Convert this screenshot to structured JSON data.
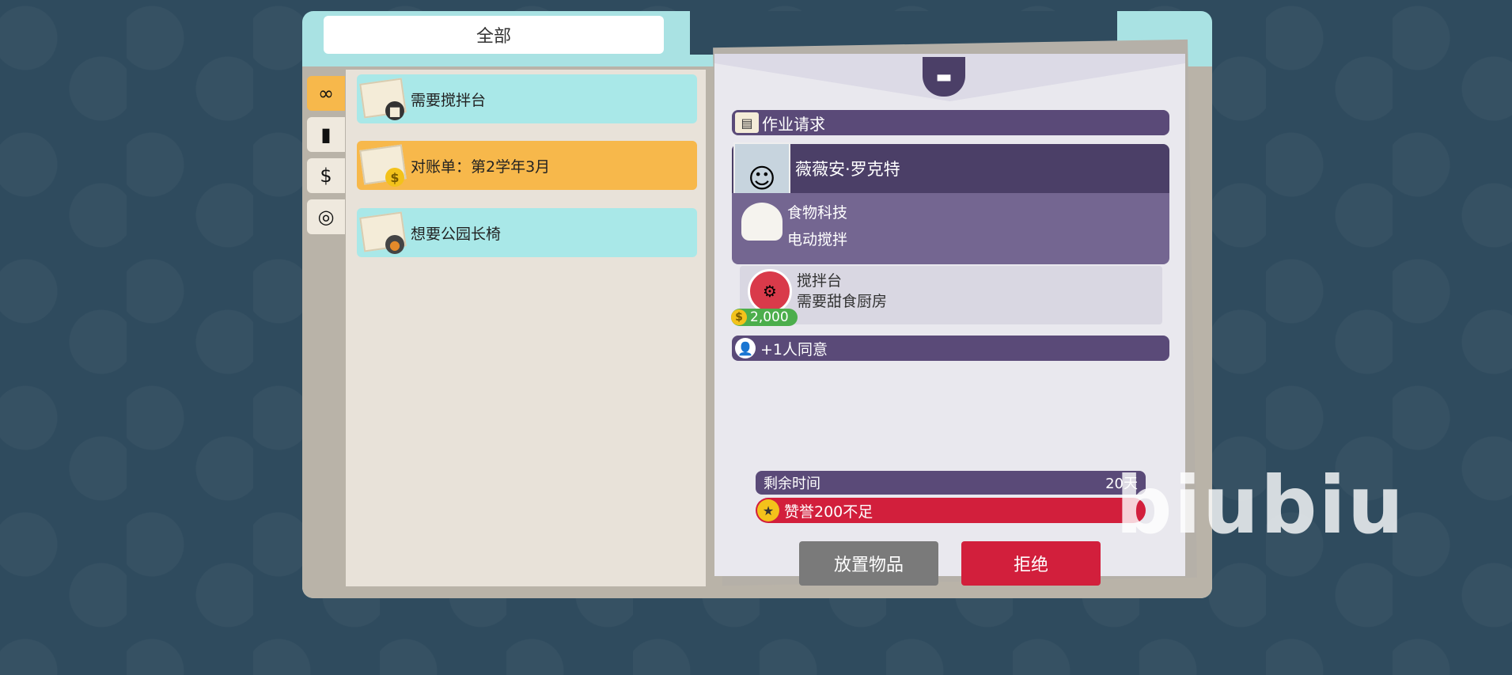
{
  "category": {
    "label": "全部"
  },
  "side_tabs": [
    {
      "icon": "infinity-icon",
      "glyph": "∞",
      "active": true
    },
    {
      "icon": "book-icon",
      "glyph": "📖",
      "active": false
    },
    {
      "icon": "dollar-icon",
      "glyph": "$",
      "active": false
    },
    {
      "icon": "target-icon",
      "glyph": "◎",
      "active": false
    }
  ],
  "list": [
    {
      "label": "需要搅拌台",
      "badge": "■",
      "color": "teal"
    },
    {
      "label": "对账单：第2学年3月",
      "badge": "$",
      "color": "orange"
    },
    {
      "label": "想要公园长椅",
      "badge": "●",
      "color": "teal"
    }
  ],
  "request": {
    "header": "作业请求",
    "student_name": "薇薇安·罗克特",
    "tech_category": "食物科技",
    "tech_name": "电动搅拌",
    "item_name": "搅拌台",
    "item_requirement": "需要甜食厨房",
    "price": "2,000",
    "agree": "+1人同意",
    "time_label": "剩余时间",
    "time_value": "20天",
    "prestige_warning": "赞誉200不足"
  },
  "buttons": {
    "place": "放置物品",
    "reject": "拒绝"
  },
  "watermark": "biubiu",
  "colors": {
    "teal": "#a9e8e8",
    "orange": "#f7b84b",
    "purple": "#5a4a78",
    "red": "#d21f3c",
    "green": "#4cae4c"
  }
}
